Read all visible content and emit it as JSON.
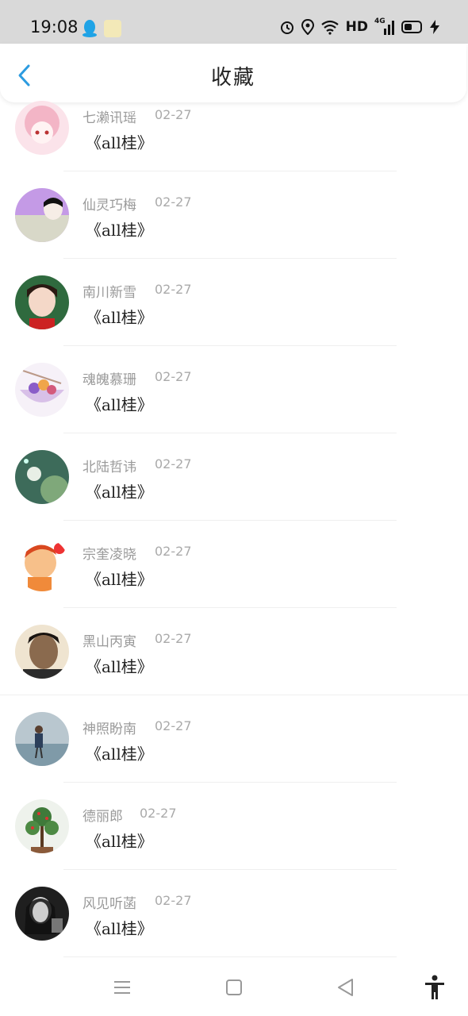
{
  "status_bar": {
    "time": "19:08",
    "network": "HD",
    "cellular": "4G",
    "icons": [
      "qq-icon",
      "app-icon",
      "alarm-icon",
      "location-icon",
      "wifi-icon",
      "signal-icon",
      "battery-icon",
      "charging-icon"
    ]
  },
  "header": {
    "title": "收藏",
    "back_icon": "chevron-left-icon"
  },
  "favorites": [
    {
      "user": "七濑讯瑶",
      "date": "02-27",
      "title": "《all桂》",
      "avatar_color": "#f3c6d1"
    },
    {
      "user": "仙灵巧梅",
      "date": "02-27",
      "title": "《all桂》",
      "avatar_color": "#b48be0"
    },
    {
      "user": "南川新雪",
      "date": "02-27",
      "title": "《all桂》",
      "avatar_color": "#2e6b3e"
    },
    {
      "user": "魂魄慕珊",
      "date": "02-27",
      "title": "《all桂》",
      "avatar_color": "#e8d8f0"
    },
    {
      "user": "北陆哲讳",
      "date": "02-27",
      "title": "《all桂》",
      "avatar_color": "#4f7f6a"
    },
    {
      "user": "宗奎凌晓",
      "date": "02-27",
      "title": "《all桂》",
      "avatar_color": "#f6b37a"
    },
    {
      "user": "黑山丙寅",
      "date": "02-27",
      "title": "《all桂》",
      "avatar_color": "#6b4a2e"
    },
    {
      "user": "神照盼南",
      "date": "02-27",
      "title": "《all桂》",
      "avatar_color": "#9fb3bf"
    },
    {
      "user": "德丽郎",
      "date": "02-27",
      "title": "《all桂》",
      "avatar_color": "#9dbd8a"
    },
    {
      "user": "风见听菡",
      "date": "02-27",
      "title": "《all桂》",
      "avatar_color": "#2b2b2b"
    }
  ],
  "navbar": {
    "icons": [
      "menu-icon",
      "home-icon",
      "back-triangle-icon",
      "accessibility-icon"
    ]
  },
  "colors": {
    "accent": "#2c9be0",
    "muted_text": "#9a9a9a"
  }
}
